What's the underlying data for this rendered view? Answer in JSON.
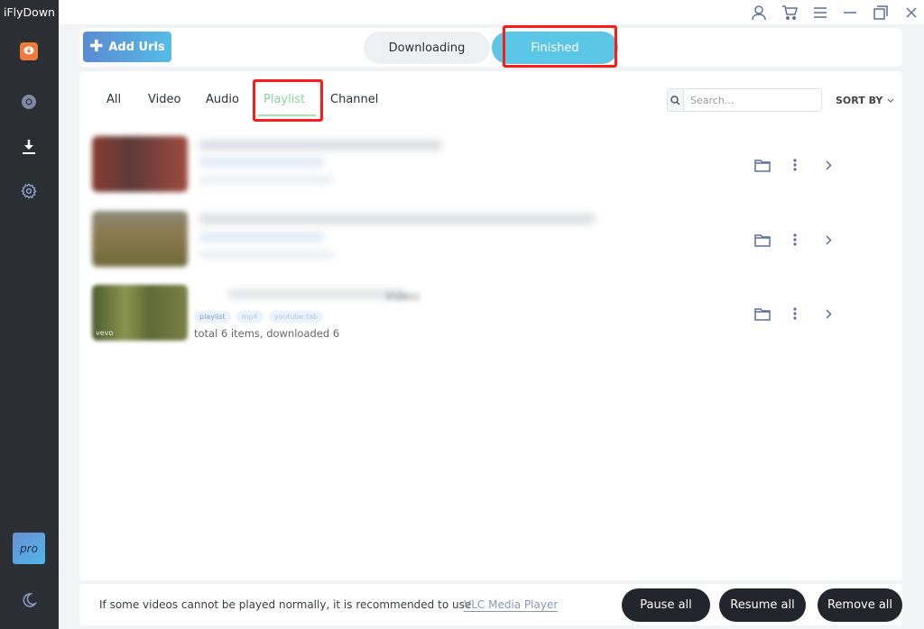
{
  "app": {
    "title": "iFlyDown"
  },
  "sidebar": {
    "items": [
      {
        "name": "app-logo",
        "icon": "download-bubble-icon"
      },
      {
        "name": "browser",
        "icon": "chrome-icon"
      },
      {
        "name": "downloads",
        "icon": "download-icon"
      },
      {
        "name": "settings",
        "icon": "gear-icon"
      }
    ],
    "pro_label": "pro",
    "theme_icon": "moon-icon"
  },
  "titlebar": {
    "icons": [
      "user-icon",
      "cart-icon",
      "menu-icon",
      "minimize-icon",
      "restore-icon",
      "close-icon"
    ]
  },
  "header": {
    "add_urls_label": "Add Urls",
    "tabs": [
      {
        "label": "Downloading",
        "active": false
      },
      {
        "label": "Finished",
        "active": true
      }
    ]
  },
  "filters": {
    "tabs": [
      {
        "label": "All",
        "active": false
      },
      {
        "label": "Video",
        "active": false
      },
      {
        "label": "Audio",
        "active": false
      },
      {
        "label": "Playlist",
        "active": true
      },
      {
        "label": "Channel",
        "active": false
      }
    ],
    "search_placeholder": "Search...",
    "search_value": "",
    "sort_label": "SORT BY"
  },
  "items": [
    {
      "title": "",
      "tags": [],
      "status": ""
    },
    {
      "title": "",
      "tags": [],
      "status": ""
    },
    {
      "title": "Video)",
      "thumb_label": "vevo",
      "tags": [
        "playlist",
        "mp4",
        "youtube:tab"
      ],
      "status": "total 6 items, downloaded 6"
    }
  ],
  "footer": {
    "message": "If some videos cannot be played normally, it is recommended to use",
    "link": "VLC Media Player",
    "buttons": [
      "Pause all",
      "Resume all",
      "Remove all"
    ]
  },
  "colors": {
    "accent": "#5bc6e6",
    "active_filter": "#8fd39a",
    "sidebar_bg": "#2b2e32",
    "highlight": "#ff1a1a"
  }
}
